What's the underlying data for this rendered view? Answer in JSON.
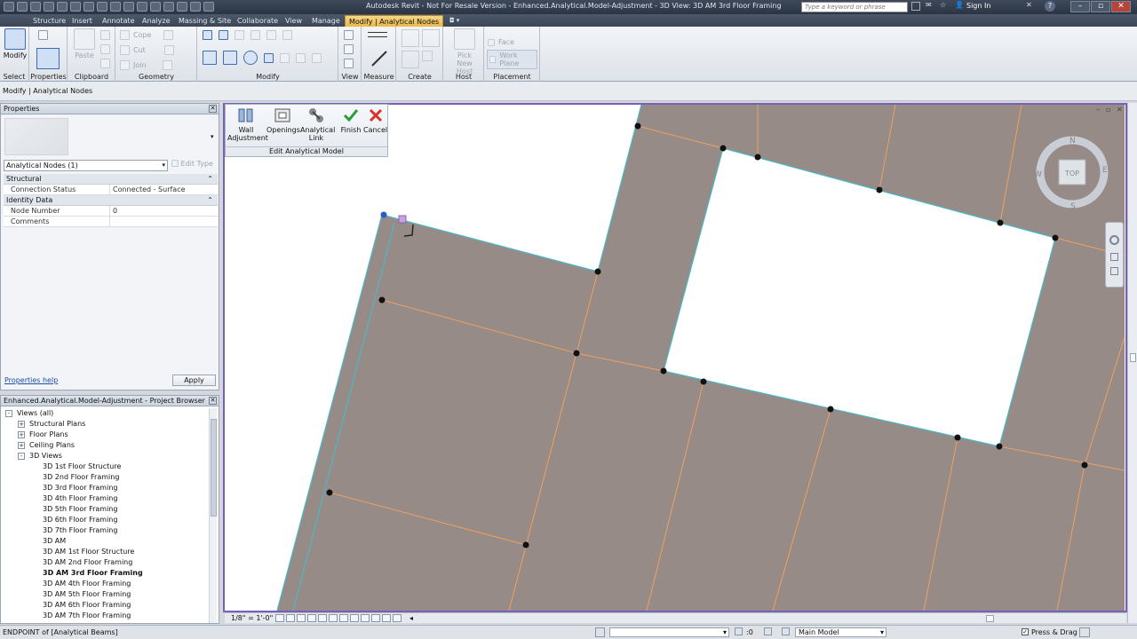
{
  "window": {
    "title": "Autodesk Revit - Not For Resale Version -    Enhanced.Analytical.Model-Adjustment - 3D View: 3D AM 3rd Floor Framing",
    "search_placeholder": "Type a keyword or phrase",
    "sign_in": "Sign In",
    "help_symbol": "?"
  },
  "ribbon_tabs": [
    "Structure",
    "Insert",
    "Annotate",
    "Analyze",
    "Massing & Site",
    "Collaborate",
    "View",
    "Manage",
    "Modify | Analytical Nodes"
  ],
  "ribbon": {
    "modify": "Modify",
    "paste": "Paste",
    "cope": "Cope",
    "cut": "Cut",
    "join": "Join",
    "pick_new_host": "Pick New Host",
    "face": "Face",
    "work_plane": "Work Plane",
    "panels": [
      "Select",
      "Properties",
      "Clipboard",
      "Geometry",
      "Modify",
      "View",
      "Measure",
      "Create",
      "Host",
      "Placement"
    ]
  },
  "options_bar": {
    "label": "Modify | Analytical Nodes"
  },
  "properties": {
    "title": "Properties",
    "type_selector": "Analytical Nodes (1)",
    "edit_type": "Edit Type",
    "groups": [
      {
        "name": "Structural",
        "rows": [
          {
            "key": "Connection Status",
            "value": "Connected - Surface"
          }
        ]
      },
      {
        "name": "Identity Data",
        "rows": [
          {
            "key": "Node Number",
            "value": "0"
          },
          {
            "key": "Comments",
            "value": ""
          }
        ]
      }
    ],
    "help": "Properties help",
    "apply": "Apply"
  },
  "project_browser": {
    "title": "Enhanced.Analytical.Model-Adjustment - Project Browser",
    "items": [
      {
        "label": "Views (all)",
        "level": 0,
        "expander": "-"
      },
      {
        "label": "Structural Plans",
        "level": 1,
        "expander": "+"
      },
      {
        "label": "Floor Plans",
        "level": 1,
        "expander": "+"
      },
      {
        "label": "Ceiling Plans",
        "level": 1,
        "expander": "+"
      },
      {
        "label": "3D Views",
        "level": 1,
        "expander": "-"
      },
      {
        "label": "3D 1st Floor Structure",
        "level": 2
      },
      {
        "label": "3D 2nd Floor Framing",
        "level": 2
      },
      {
        "label": "3D 3rd Floor Framing",
        "level": 2
      },
      {
        "label": "3D 4th Floor Framing",
        "level": 2
      },
      {
        "label": "3D 5th Floor Framing",
        "level": 2
      },
      {
        "label": "3D 6th Floor Framing",
        "level": 2
      },
      {
        "label": "3D 7th Floor Framing",
        "level": 2
      },
      {
        "label": "3D AM",
        "level": 2
      },
      {
        "label": "3D AM 1st Floor Structure",
        "level": 2
      },
      {
        "label": "3D AM 2nd Floor Framing",
        "level": 2
      },
      {
        "label": "3D AM 3rd Floor Framing",
        "level": 2,
        "bold": true
      },
      {
        "label": "3D AM 4th Floor Framing",
        "level": 2
      },
      {
        "label": "3D AM 5th Floor Framing",
        "level": 2
      },
      {
        "label": "3D AM 6th Floor Framing",
        "level": 2
      },
      {
        "label": "3D AM 7th Floor Framing",
        "level": 2
      }
    ]
  },
  "edit_panel": {
    "buttons": [
      {
        "label": "Wall Adjustment"
      },
      {
        "label": "Openings"
      },
      {
        "label": "Analytical Link"
      },
      {
        "label": "Finish"
      },
      {
        "label": "Cancel"
      }
    ],
    "title": "Edit Analytical Model"
  },
  "viewcube": {
    "face": "TOP",
    "north": "N",
    "south": "S",
    "east": "E",
    "west": "W"
  },
  "view_bar": {
    "scale": "1/8\" = 1'-0\""
  },
  "status_bar": {
    "message": "ENDPOINT  of [Analytical Beams]",
    "zero": ":0",
    "model": "Main Model",
    "press_drag": "Press & Drag"
  },
  "colors": {
    "slab_fill": "#968b86",
    "beam_line": "#f0a060",
    "edge_line": "#49b8c8",
    "selection_frame": "#7a5fb8",
    "active_tab": "#f1c665"
  }
}
